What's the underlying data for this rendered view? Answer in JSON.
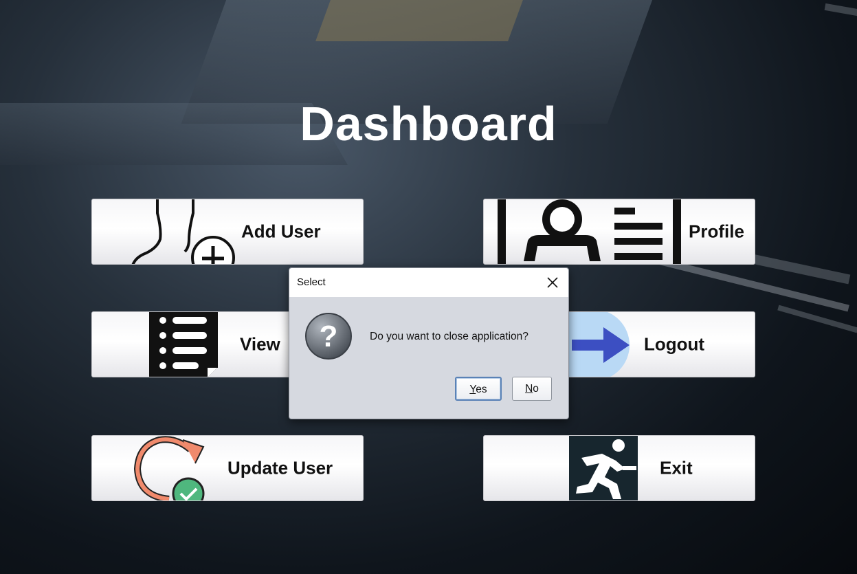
{
  "page": {
    "title": "Dashboard"
  },
  "tiles": {
    "add_user": {
      "label": "Add User",
      "icon": "add-user-icon"
    },
    "profile": {
      "label": "Profile",
      "icon": "profile-icon"
    },
    "view": {
      "label": "View",
      "icon": "list-icon"
    },
    "logout": {
      "label": "Logout",
      "icon": "logout-arrow-icon"
    },
    "update_user": {
      "label": "Update User",
      "icon": "refresh-check-icon"
    },
    "exit": {
      "label": "Exit",
      "icon": "running-man-icon"
    }
  },
  "dialog": {
    "title": "Select",
    "message": "Do you want to close application?",
    "yes_mnemonic": "Y",
    "yes_rest": "es",
    "no_mnemonic": "N",
    "no_rest": "o"
  },
  "colors": {
    "update_icon_orange": "#f08a6c",
    "update_icon_green": "#4fb77e",
    "logout_arrow": "#3c4fc2",
    "logout_circle": "#b9d9f5",
    "exit_icon_bg": "#17262e"
  }
}
